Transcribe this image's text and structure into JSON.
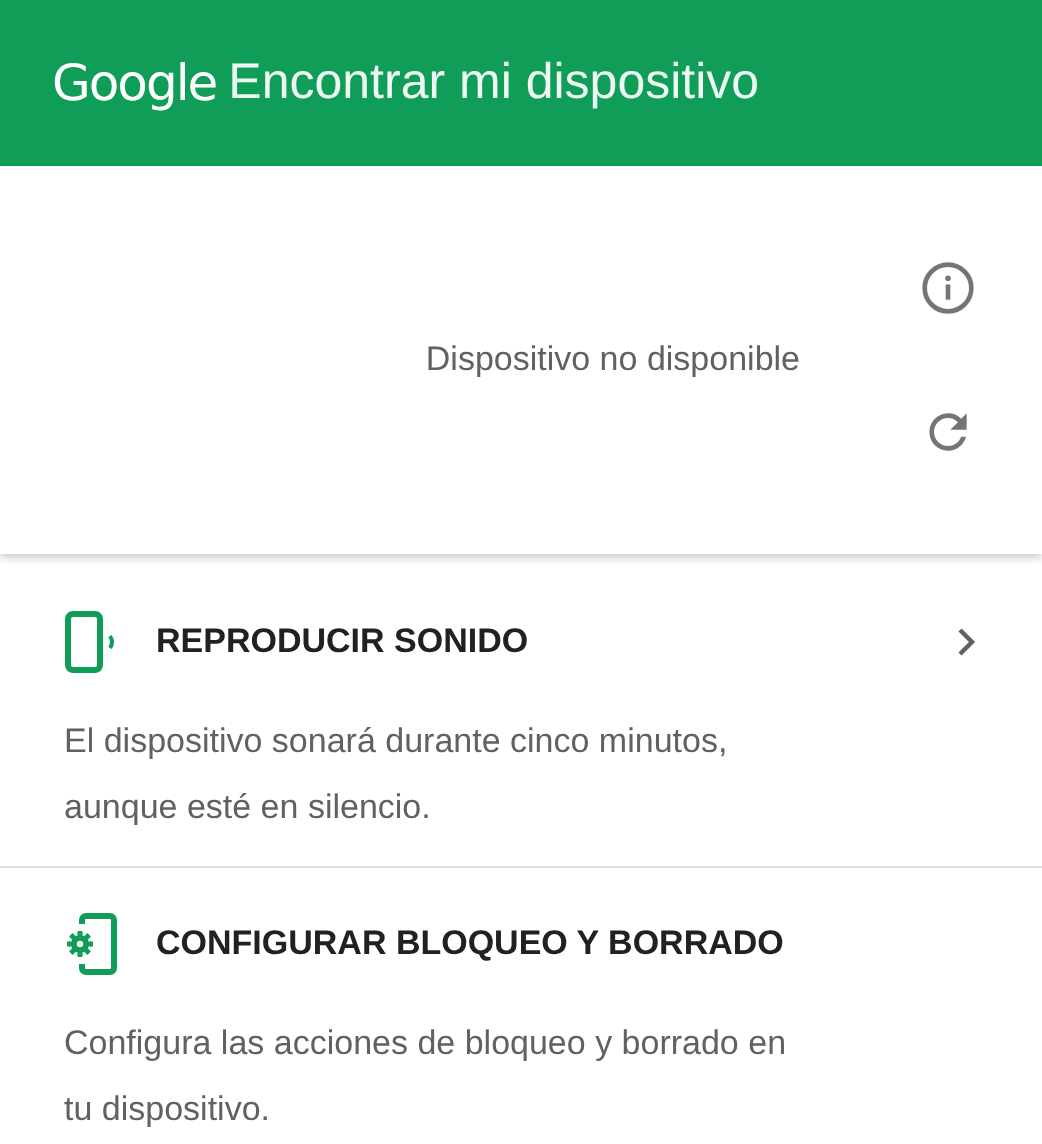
{
  "header": {
    "brand": "Google",
    "title": "Encontrar mi dispositivo"
  },
  "device_panel": {
    "status": "Dispositivo no disponible"
  },
  "actions": [
    {
      "kind": "sound",
      "title": "REPRODUCIR SONIDO",
      "description": "El dispositivo sonará durante cinco minutos, aunque esté en silencio.",
      "has_arrow": true
    },
    {
      "kind": "lock",
      "title": "CONFIGURAR BLOQUEO Y BORRADO",
      "description": "Configura las acciones de bloqueo y borrado en tu dispositivo.",
      "has_arrow": false
    }
  ]
}
